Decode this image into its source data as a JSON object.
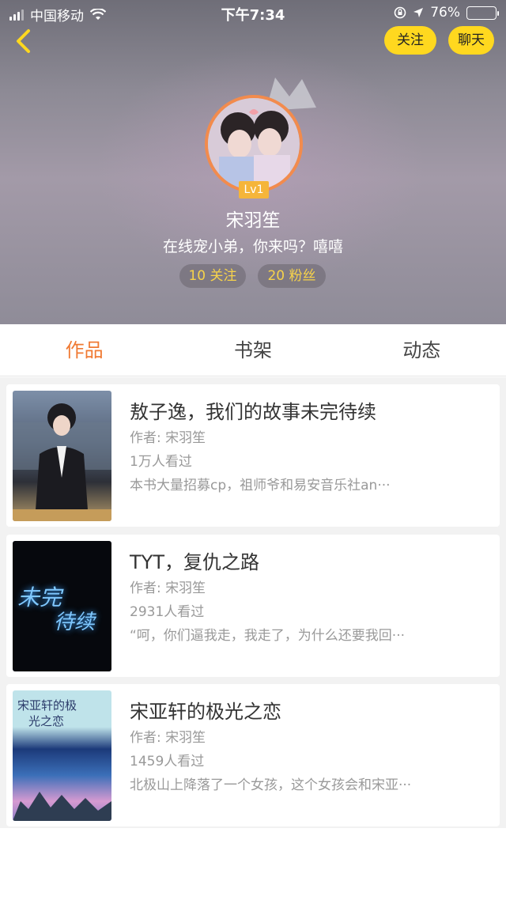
{
  "status_bar": {
    "carrier": "中国移动",
    "time": "下午7:34",
    "battery": "76%",
    "battery_level": 0.76
  },
  "header": {
    "follow_label": "关注",
    "chat_label": "聊天",
    "level": "Lv1",
    "username": "宋羽笙",
    "bio": "在线宠小弟，你来吗？嘻嘻",
    "following": "10 关注",
    "fans": "20 粉丝"
  },
  "tabs": [
    {
      "label": "作品",
      "active": true
    },
    {
      "label": "书架",
      "active": false
    },
    {
      "label": "动态",
      "active": false
    }
  ],
  "colors": {
    "accent": "#f07a33",
    "button_yellow": "#ffd81f",
    "pill_text": "#f7d34a"
  },
  "works": [
    {
      "title": "敖子逸，我们的故事未完待续",
      "author": "作者: 宋羽笙",
      "views": "1万人看过",
      "desc": "本书大量招募cp，祖师爷和易安音乐社an···"
    },
    {
      "title": "TYT，复仇之路",
      "author": "作者: 宋羽笙",
      "views": "2931人看过",
      "desc": "“呵，你们逼我走，我走了，为什么还要我回···",
      "cover_text_1": "未完",
      "cover_text_2": "待续"
    },
    {
      "title": "宋亚轩的极光之恋",
      "author": "作者: 宋羽笙",
      "views": "1459人看过",
      "desc": "北极山上降落了一个女孩，这个女孩会和宋亚···",
      "cover_text_1": "宋亚轩的极",
      "cover_text_2": "光之恋"
    }
  ]
}
